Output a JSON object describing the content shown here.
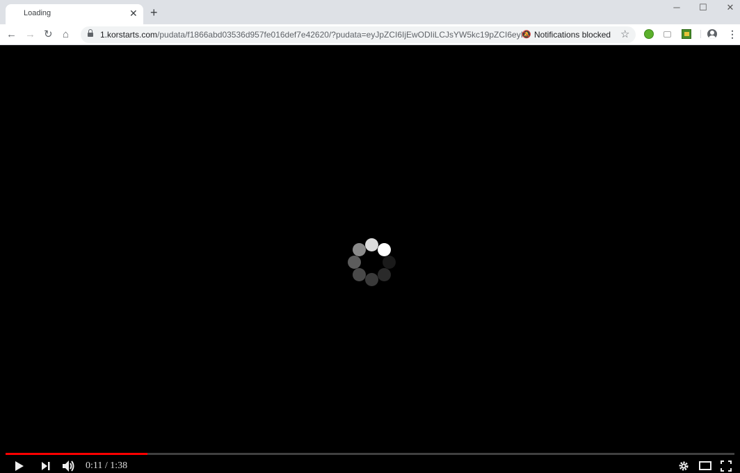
{
  "browser": {
    "tab": {
      "title": "Loading",
      "close_icon": "close-icon"
    },
    "new_tab_label": "+",
    "window_controls": {
      "minimize": "─",
      "maximize": "☐",
      "close": "✕"
    },
    "nav": {
      "back": "←",
      "forward": "→",
      "reload": "↻",
      "home": "⌂"
    },
    "address": {
      "host": "1.korstarts.com",
      "path": "/pudata/f1866abd03536d957fe016def7e42620/?pudata=eyJpZCI6IjEwODIiLCJsYW5kc19pZCI6eyI..."
    },
    "notifications_label": "Notifications blocked",
    "star_icon": "☆",
    "menu_icon": "⋮"
  },
  "player": {
    "current_time": "0:11",
    "duration": "1:38",
    "time_display": "0:11 / 1:38",
    "progress_fraction": 0.195,
    "state": "loading",
    "spinner_colors": [
      "#dcdcdc",
      "#ffffff",
      "#1a1a1a",
      "#2a2a2a",
      "#3a3a3a",
      "#494949",
      "#5c5c5c",
      "#8a8a8a"
    ],
    "accent_color": "#ff0000"
  }
}
